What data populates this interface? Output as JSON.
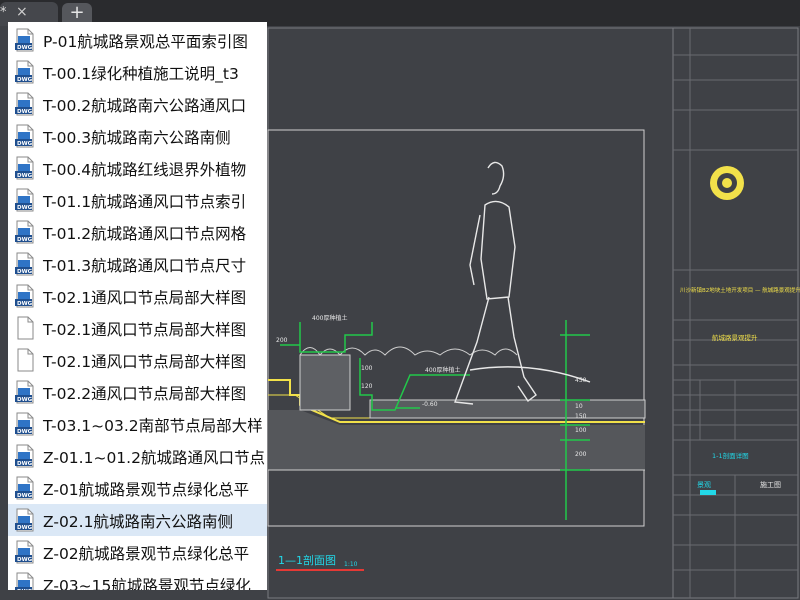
{
  "tabs": {
    "active_marker": "*",
    "close_glyph": "×",
    "new_tab_glyph": "+"
  },
  "files": [
    {
      "name": "P-01航城路景观总平面索引图",
      "icon": "dwg-file-icon"
    },
    {
      "name": "T-00.1绿化种植施工说明_t3",
      "icon": "dwg-file-icon"
    },
    {
      "name": "T-00.2航城路南六公路通风口",
      "icon": "dwg-file-icon"
    },
    {
      "name": "T-00.3航城路南六公路南侧",
      "icon": "dwg-file-icon"
    },
    {
      "name": "T-00.4航城路红线退界外植物",
      "icon": "dwg-file-icon"
    },
    {
      "name": "T-01.1航城路通风口节点索引",
      "icon": "dwg-file-icon"
    },
    {
      "name": "T-01.2航城路通风口节点网格",
      "icon": "dwg-file-icon"
    },
    {
      "name": "T-01.3航城路通风口节点尺寸",
      "icon": "dwg-file-icon"
    },
    {
      "name": "T-02.1通风口节点局部大样图",
      "icon": "dwg-file-icon"
    },
    {
      "name": "T-02.1通风口节点局部大样图",
      "icon": "blank-file-icon"
    },
    {
      "name": "T-02.1通风口节点局部大样图",
      "icon": "blank-file-icon"
    },
    {
      "name": "T-02.2通风口节点局部大样图",
      "icon": "dwg-file-icon"
    },
    {
      "name": "T-03.1~03.2南部节点局部大样",
      "icon": "dwg-file-icon"
    },
    {
      "name": "Z-01.1~01.2航城路通风口节点",
      "icon": "dwg-file-icon"
    },
    {
      "name": "Z-01航城路景观节点绿化总平",
      "icon": "dwg-file-icon"
    },
    {
      "name": "Z-02.1航城路南六公路南侧",
      "icon": "dwg-file-icon",
      "selected": true
    },
    {
      "name": "Z-02航城路景观节点绿化总平",
      "icon": "dwg-file-icon"
    },
    {
      "name": "Z-03~15航城路景观节点绿化",
      "icon": "dwg-file-icon"
    }
  ],
  "drawing": {
    "section_title": "1—1剖面图",
    "scale": "1:10",
    "dim_labels": [
      "200",
      "100",
      "120",
      "450",
      "100",
      "150",
      "10",
      "200"
    ],
    "callouts": [
      "400厚种植土",
      "400厚种植土",
      "-0.60"
    ],
    "title_block": {
      "project": "川沙新镇B2地块土地开发项目 — 航城路景观提升专项工程",
      "drawing_name": "航城路景观提升",
      "sheet": "1-1剖面详图",
      "stage_label": "景观",
      "stage_value": "施工图"
    }
  }
}
